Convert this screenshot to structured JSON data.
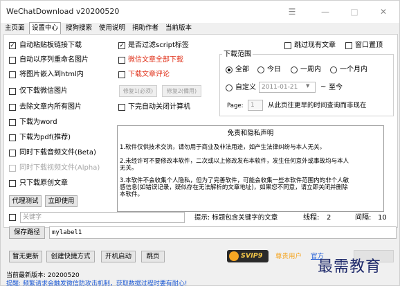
{
  "window": {
    "title": "WeChatDownload v20200520",
    "controls": {
      "menu": "☰",
      "minimize": "—",
      "maximize": "□",
      "close": "✕"
    }
  },
  "tabs": [
    "主页面",
    "设置中心",
    "搜狗搜索",
    "使用说明",
    "捐助作者",
    "当前版本"
  ],
  "active_tab_index": 1,
  "left_options": [
    {
      "label": "自动粘贴板链接下载",
      "checked": true,
      "style": "normal"
    },
    {
      "label": "自动以序列重命名图片",
      "checked": false,
      "style": "normal"
    },
    {
      "label": "将图片嵌入到html内",
      "checked": false,
      "style": "normal"
    },
    {
      "label": "仅下载微信图片",
      "checked": false,
      "style": "normal"
    },
    {
      "label": "去除文章内所有图片",
      "checked": false,
      "style": "normal"
    },
    {
      "label": "下载为word",
      "checked": false,
      "style": "normal"
    },
    {
      "label": "下载为pdf(推荐)",
      "checked": false,
      "style": "normal"
    },
    {
      "label": "同时下载音频文件(Beta)",
      "checked": false,
      "style": "normal"
    },
    {
      "label": "同时下载视频文件(Alpha)",
      "checked": false,
      "style": "disabled"
    },
    {
      "label": "只下载原创文章",
      "checked": false,
      "style": "normal"
    }
  ],
  "middle_options": [
    {
      "label": "是否过滤script标签",
      "checked": true,
      "style": "normal"
    },
    {
      "label": "微信文章全部下载",
      "checked": false,
      "style": "red"
    },
    {
      "label": "下载文章评论",
      "checked": false,
      "style": "red"
    }
  ],
  "fix_buttons": {
    "fix1": "修复1(必须)",
    "fix2": "修复2(備用)"
  },
  "shutdown_option": {
    "label": "下完自动关闭计算机",
    "checked": false
  },
  "top_right_options": [
    {
      "label": "跳过现有文章",
      "checked": false
    },
    {
      "label": "窗口置顶",
      "checked": false
    }
  ],
  "download_range": {
    "title": "下载范围",
    "radios": [
      {
        "label": "全部",
        "selected": true
      },
      {
        "label": "今日",
        "selected": false
      },
      {
        "label": "一周内",
        "selected": false
      },
      {
        "label": "一个月内",
        "selected": false
      }
    ],
    "custom_label": "自定义",
    "custom_selected": false,
    "date_value": "2011-01-21",
    "date_dropdown": "▼",
    "tilde": "~",
    "until_label": "至今",
    "page_label": "Page:",
    "page_value": "1",
    "page_hint": "从此页往更早的时间查询而非现在"
  },
  "notice": {
    "title": "免责和隐私声明",
    "lines": [
      "1.软件仅供技术交流，请勿用于商业及非法用途，如产生法律纠纷与本人无关。",
      "2.未经许可不要修改本软件，二次或以上修改发布本软件，发生任何意外或事故均与本人",
      "无关。",
      "3.本软件不会收集个人隐私，但为了完善软件，可能会收集一些本软件范围内的非个人敏",
      "感信息(如错误记录，疑似存在无法解析的文章地址)，如果您不同意，请立即关闭并删除",
      "本软件。"
    ]
  },
  "proxy_buttons": {
    "test": "代理测试",
    "use": "立即使用"
  },
  "keyword": {
    "checked": false,
    "placeholder": "关键字",
    "hint": "提示: 标题包含关键字的文章",
    "threads_label": "线程:",
    "threads_value": "2",
    "interval_label": "间隔:",
    "interval_value": "10"
  },
  "save_path": {
    "button": "保存路径",
    "value": "mylabel1"
  },
  "bottom_buttons": [
    "暂无更新",
    "创建快捷方式",
    "开机启动",
    "跳页"
  ],
  "vip": {
    "badge": "SVIP9",
    "user_label": "尊贵用户",
    "link_text": "官方"
  },
  "status": {
    "version_line": "当前最新版本: 20200520",
    "tip_line": "提醒: 频繁请求会触发微信防攻击机制，获取数据过程时要有耐心!"
  },
  "watermark": "最需教育",
  "colors": {
    "accent_red": "#e0311a",
    "vip_orange": "#f5a623",
    "status_blue": "#1e5bd6",
    "watermark_navy": "#1f2a6b"
  }
}
